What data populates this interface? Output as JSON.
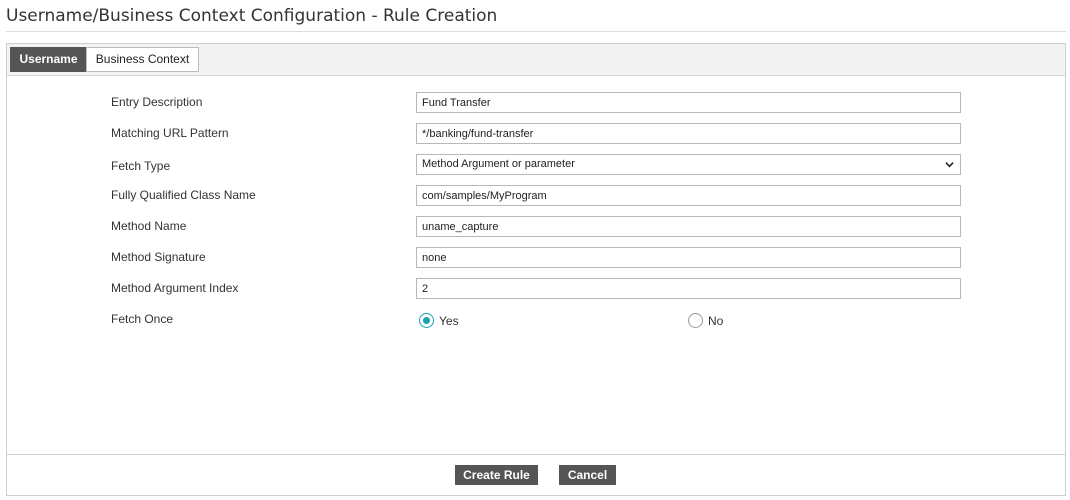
{
  "page": {
    "title": "Username/Business Context Configuration - Rule Creation"
  },
  "tabs": [
    {
      "label": "Username",
      "active": true
    },
    {
      "label": "Business Context",
      "active": false
    }
  ],
  "form": {
    "entry_description": {
      "label": "Entry Description",
      "value": "Fund Transfer"
    },
    "matching_url_pattern": {
      "label": "Matching URL Pattern",
      "value": "*/banking/fund-transfer"
    },
    "fetch_type": {
      "label": "Fetch Type",
      "value": "Method Argument or parameter"
    },
    "class_name": {
      "label": "Fully Qualified Class Name",
      "value": "com/samples/MyProgram"
    },
    "method_name": {
      "label": "Method Name",
      "value": "uname_capture"
    },
    "method_signature": {
      "label": "Method Signature",
      "value": "none"
    },
    "method_argument_index": {
      "label": "Method Argument Index",
      "value": "2"
    },
    "fetch_once": {
      "label": "Fetch Once",
      "options": [
        {
          "label": "Yes",
          "checked": true
        },
        {
          "label": "No",
          "checked": false
        }
      ]
    }
  },
  "actions": {
    "create_label": "Create Rule",
    "cancel_label": "Cancel"
  },
  "colors": {
    "accent": "#1aa3b5",
    "button_bg": "#555555",
    "active_tab_bg": "#555555"
  }
}
